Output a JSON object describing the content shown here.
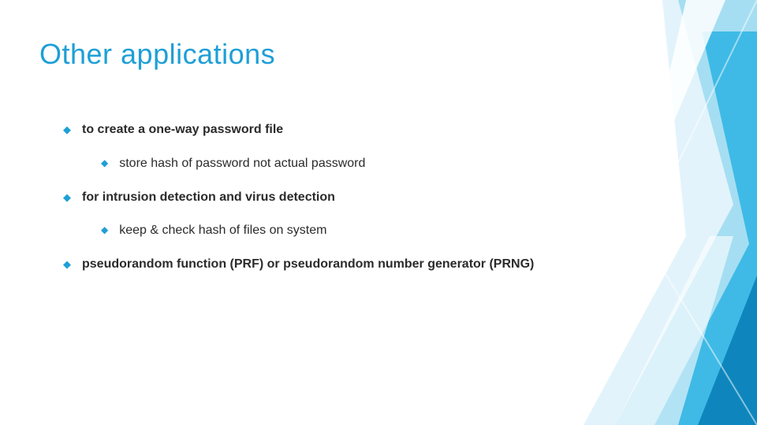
{
  "title": "Other applications",
  "bullets": [
    {
      "text": "to create a one-way password file",
      "bold": true
    },
    {
      "text": "store hash of password not actual password",
      "bold": false,
      "sub": true
    },
    {
      "text": "for intrusion detection and virus detection",
      "bold": true
    },
    {
      "text": "keep & check hash of files on system",
      "bold": false,
      "sub": true
    },
    {
      "text": "pseudorandom function (PRF) or pseudorandom number generator (PRNG)",
      "bold": true
    }
  ],
  "colors": {
    "accent": "#1e9fd6",
    "deco_mid": "#34b6e4",
    "deco_light": "#9ad9f0",
    "deco_pale": "#d6eefa"
  }
}
